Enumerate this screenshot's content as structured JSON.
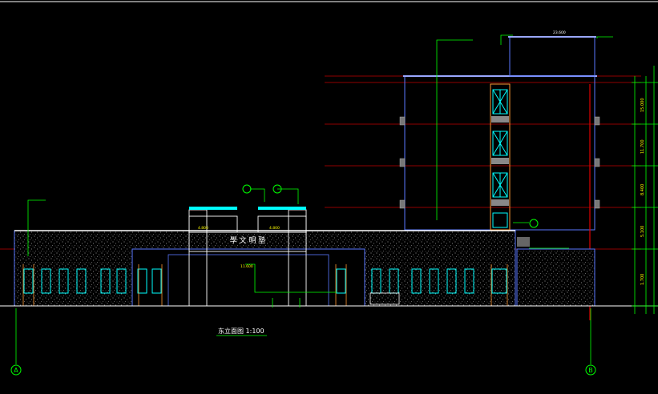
{
  "drawing": {
    "title": "东立面图 1:100",
    "axis_left": "A",
    "axis_right": "B",
    "sign_text": "學 文 明 塾",
    "top_labels": [
      "4.800",
      "4.800",
      "11.600"
    ],
    "level_labels": [
      "23.600",
      "18.400",
      "15.000",
      "11.700",
      "8.400",
      "5.100",
      "1.700",
      "±0.000",
      "-0.450"
    ]
  },
  "colors": {
    "background": "#000000",
    "outline_blue": "#5a78ff",
    "cyan": "#00ffff",
    "green": "#00ff00",
    "red": "#e00000",
    "white": "#ffffff",
    "gray": "#9a9a9a",
    "yellow": "#ffff00",
    "orange": "#ff9933"
  }
}
